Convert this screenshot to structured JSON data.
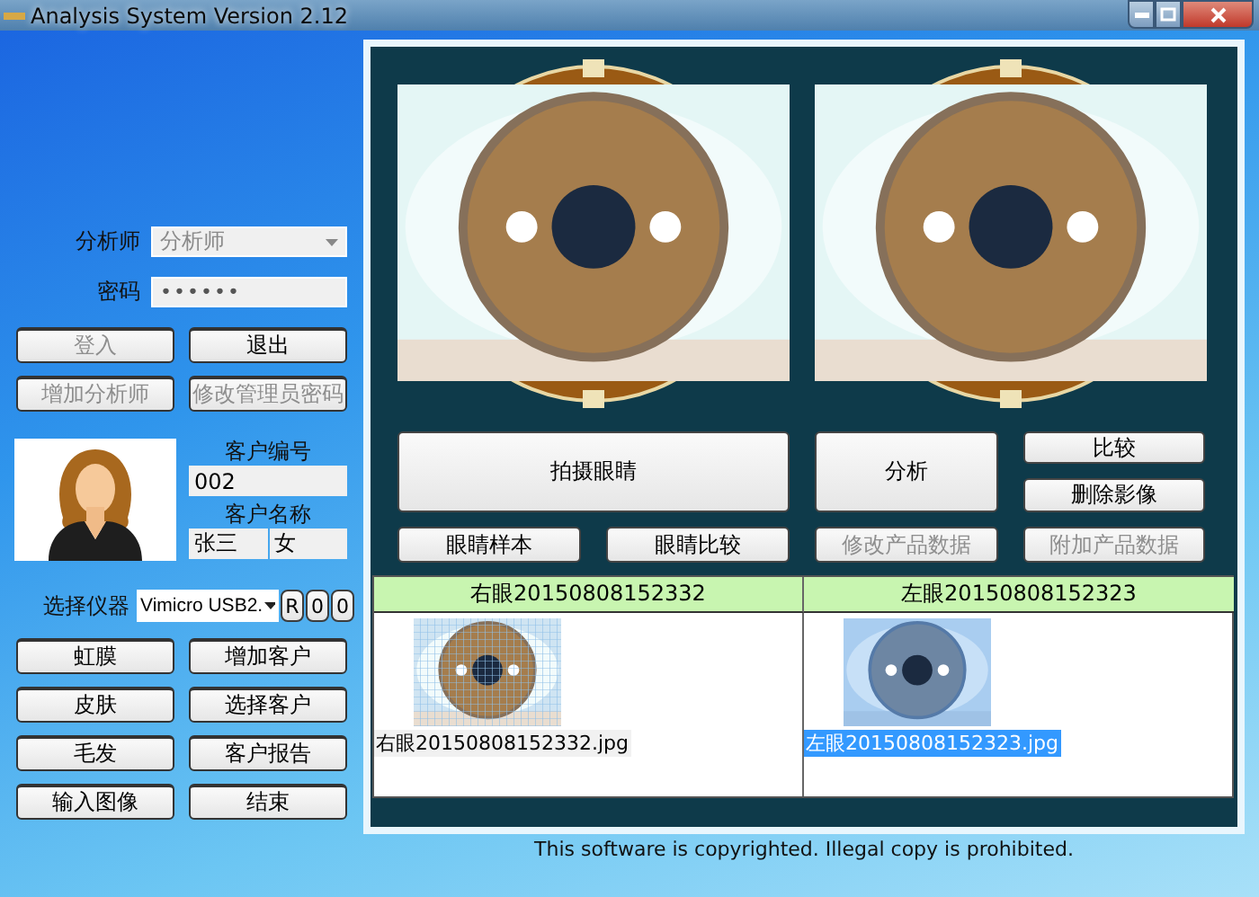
{
  "window": {
    "title": "Analysis System Version 2.12"
  },
  "login": {
    "analyst_label": "分析师",
    "analyst_combo": {
      "value": "分析师",
      "disabled": true
    },
    "password_label": "密码",
    "password": {
      "value": "••••••"
    }
  },
  "login_buttons": [
    {
      "label": "登入",
      "disabled": true
    },
    {
      "label": "退出",
      "disabled": false
    },
    {
      "label": "增加分析师",
      "disabled": true
    },
    {
      "label": "修改管理员密码",
      "disabled": true
    }
  ],
  "customer": {
    "id_label": "客户编号",
    "id": "002",
    "name_label": "客户名称",
    "name": "张三",
    "gender": "女"
  },
  "device": {
    "label": "选择仪器",
    "value": "Vimicro USB2.",
    "buttons": [
      "R",
      "0",
      "0"
    ]
  },
  "menu_buttons": [
    "虹膜",
    "增加客户",
    "皮肤",
    "选择客户",
    "毛发",
    "客户报告",
    "输入图像",
    "结束"
  ],
  "capture_buttons": [
    {
      "label": "拍摄眼睛",
      "disabled": false
    },
    {
      "label": "分析",
      "disabled": false
    },
    {
      "label": "比较",
      "disabled": false
    },
    {
      "label": "删除影像",
      "disabled": false
    },
    {
      "label": "眼睛样本",
      "disabled": false
    },
    {
      "label": "眼睛比较",
      "disabled": false
    },
    {
      "label": "修改产品数据",
      "disabled": true
    },
    {
      "label": "附加产品数据",
      "disabled": true
    }
  ],
  "image_table": {
    "columns": [
      {
        "header": "右眼20150808152332",
        "file": "右眼20150808152332.jpg",
        "selected": false
      },
      {
        "header": "左眼20150808152323",
        "file": "左眼20150808152323.jpg",
        "selected": true
      }
    ]
  },
  "footer": "This software is copyrighted. Illegal copy is prohibited."
}
